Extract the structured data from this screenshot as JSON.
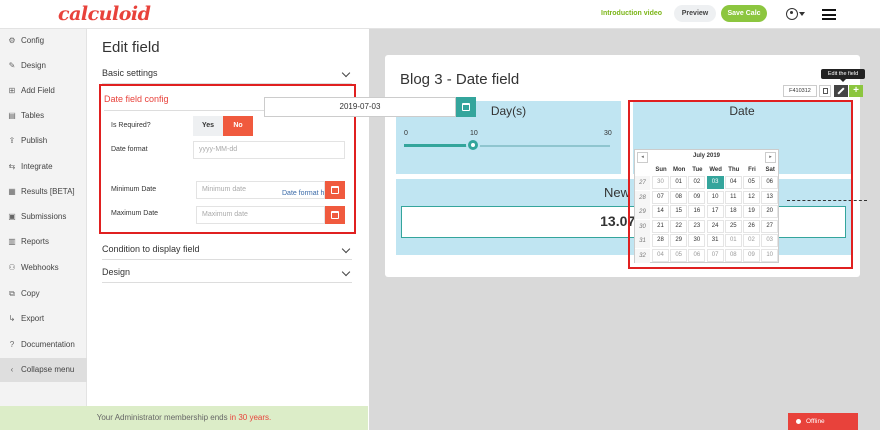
{
  "header": {
    "logo": "calculoid",
    "intro_video": "Introduction video",
    "preview": "Preview",
    "save": "Save Calc"
  },
  "sidebar": {
    "items": [
      {
        "icon": "⚙",
        "label": "Config"
      },
      {
        "icon": "✎",
        "label": "Design"
      },
      {
        "icon": "⊞",
        "label": "Add Field"
      },
      {
        "icon": "▤",
        "label": "Tables"
      },
      {
        "icon": "⇪",
        "label": "Publish"
      },
      {
        "icon": "⇆",
        "label": "Integrate"
      },
      {
        "icon": "▦",
        "label": "Results [BETA]"
      },
      {
        "icon": "▣",
        "label": "Submissions"
      },
      {
        "icon": "▥",
        "label": "Reports"
      },
      {
        "icon": "⚇",
        "label": "Webhooks"
      },
      {
        "icon": "⧉",
        "label": "Copy"
      },
      {
        "icon": "↳",
        "label": "Export"
      },
      {
        "icon": "?",
        "label": "Documentation"
      },
      {
        "icon": "‹",
        "label": "Collapse menu"
      }
    ]
  },
  "edit": {
    "title": "Edit field",
    "basic": "Basic settings",
    "config_title": "Date field config",
    "required_label": "Is Required?",
    "yes": "Yes",
    "no": "No",
    "format_label": "Date format",
    "format_placeholder": "yyyy-MM-dd",
    "format_help": "Date format help",
    "min_label": "Minimum Date",
    "min_placeholder": "Minimum date",
    "max_label": "Maximum Date",
    "max_placeholder": "Maximum date",
    "condition": "Condition to display field",
    "design": "Design"
  },
  "footer": {
    "text": "Your Administrator membership ends",
    "highlight": "in 30 years."
  },
  "preview": {
    "title": "Blog 3 - Date field",
    "tooltip": "Edit the field",
    "field_id": "F410312",
    "day_title": "Day(s)",
    "slider": {
      "min": "0",
      "max": "30",
      "value": "10",
      "fraction": 0.333
    },
    "date_title": "Date",
    "date_value": "2019-07-03",
    "new_title": "New D",
    "result": "13.07.2",
    "calendar": {
      "month": "July 2019",
      "headers": [
        "Sun",
        "Mon",
        "Tue",
        "Wed",
        "Thu",
        "Fri",
        "Sat"
      ],
      "weeks": [
        "27",
        "28",
        "29",
        "30",
        "31",
        "32"
      ],
      "days": [
        [
          "30",
          "01",
          "02",
          "03",
          "04",
          "05",
          "06"
        ],
        [
          "07",
          "08",
          "09",
          "10",
          "11",
          "12",
          "13"
        ],
        [
          "14",
          "15",
          "16",
          "17",
          "18",
          "19",
          "20"
        ],
        [
          "21",
          "22",
          "23",
          "24",
          "25",
          "26",
          "27"
        ],
        [
          "28",
          "29",
          "30",
          "31",
          "01",
          "02",
          "03"
        ],
        [
          "04",
          "05",
          "06",
          "07",
          "08",
          "09",
          "10"
        ]
      ],
      "selected": "03"
    }
  },
  "status": {
    "offline": "Offline"
  },
  "colors": {
    "brand": "#e8423b",
    "green": "#8cc63f",
    "teal": "#34a59c",
    "panel": "#c0e5f2"
  }
}
